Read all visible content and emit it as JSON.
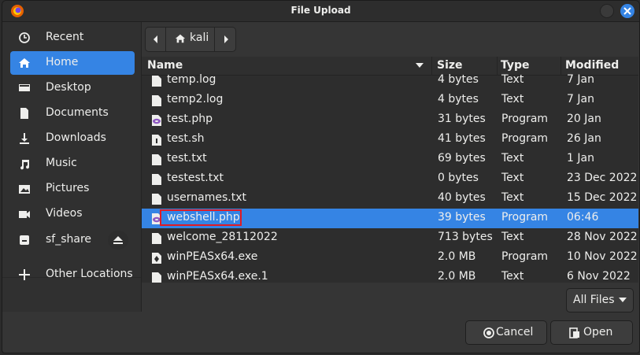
{
  "window": {
    "title": "File Upload"
  },
  "sidebar": {
    "items": [
      {
        "label": "Recent",
        "icon": "clock-icon"
      },
      {
        "label": "Home",
        "icon": "home-icon",
        "active": true
      },
      {
        "label": "Desktop",
        "icon": "desktop-icon"
      },
      {
        "label": "Documents",
        "icon": "document-icon"
      },
      {
        "label": "Downloads",
        "icon": "download-icon"
      },
      {
        "label": "Music",
        "icon": "music-icon"
      },
      {
        "label": "Pictures",
        "icon": "picture-icon"
      },
      {
        "label": "Videos",
        "icon": "video-icon"
      },
      {
        "label": "sf_share",
        "icon": "drive-icon"
      },
      {
        "label": "Other Locations",
        "icon": "plus-icon"
      }
    ]
  },
  "pathbar": {
    "current": "kali"
  },
  "columns": {
    "name": "Name",
    "size": "Size",
    "type": "Type",
    "modified": "Modified"
  },
  "files": [
    {
      "name": "temp.log",
      "size": "4 bytes",
      "type": "Text",
      "modified": "7 Jan",
      "kind": "text"
    },
    {
      "name": "temp2.log",
      "size": "4 bytes",
      "type": "Text",
      "modified": "7 Jan",
      "kind": "text"
    },
    {
      "name": "test.php",
      "size": "31 bytes",
      "type": "Program",
      "modified": "20 Jan",
      "kind": "php"
    },
    {
      "name": "test.sh",
      "size": "41 bytes",
      "type": "Program",
      "modified": "26 Jan",
      "kind": "script"
    },
    {
      "name": "test.txt",
      "size": "69 bytes",
      "type": "Text",
      "modified": "1 Jan",
      "kind": "text"
    },
    {
      "name": "testest.txt",
      "size": "0 bytes",
      "type": "Text",
      "modified": "23 Dec 2022",
      "kind": "text"
    },
    {
      "name": "usernames.txt",
      "size": "40 bytes",
      "type": "Text",
      "modified": "15 Dec 2022",
      "kind": "text"
    },
    {
      "name": "webshell.php",
      "size": "39 bytes",
      "type": "Program",
      "modified": "06:46",
      "kind": "php",
      "selected": true
    },
    {
      "name": "welcome_28112022",
      "size": "713 bytes",
      "type": "Text",
      "modified": "28 Nov 2022",
      "kind": "text"
    },
    {
      "name": "winPEASx64.exe",
      "size": "2.0 MB",
      "type": "Program",
      "modified": "10 Nov 2022",
      "kind": "exe"
    },
    {
      "name": "winPEASx64.exe.1",
      "size": "2.0 MB",
      "type": "Text",
      "modified": "6 Nov 2022",
      "kind": "text"
    }
  ],
  "filter": {
    "label": "All Files"
  },
  "buttons": {
    "cancel": "Cancel",
    "open": "Open"
  },
  "colors": {
    "accent": "#3584e4",
    "highlight_box": "#e01b24",
    "php_icon": "#8f5ac2"
  }
}
